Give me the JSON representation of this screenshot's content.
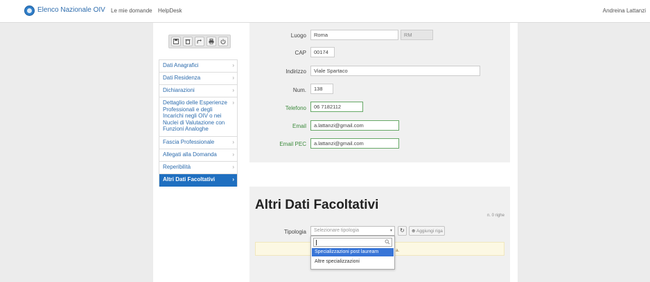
{
  "navbar": {
    "brand": "Elenco Nazionale OIV",
    "links": [
      "Le mie domande",
      "HelpDesk"
    ],
    "user": "Andreina Lattanzi"
  },
  "toolbar": {
    "buttons": [
      "save-icon",
      "delete-icon",
      "share-icon",
      "print-icon",
      "power-icon"
    ]
  },
  "menu": {
    "items": [
      {
        "label": "Dati Anagrafici"
      },
      {
        "label": "Dati Residenza"
      },
      {
        "label": "Dichiarazioni"
      },
      {
        "label": "Dettaglio delle Esperienze Professionali e degli Incarichi negli OIV o nei Nuclei di Valutazione con Funzioni Analoghe"
      },
      {
        "label": "Fascia Professionale"
      },
      {
        "label": "Allegati alla Domanda"
      },
      {
        "label": "Reperibilità"
      },
      {
        "label": "Altri Dati Facoltativi",
        "active": true
      }
    ],
    "chevron": "›",
    "chevron_active": "›"
  },
  "form": {
    "luogo": {
      "label": "Luogo",
      "value": "Roma",
      "prov": "RM"
    },
    "cap": {
      "label": "CAP",
      "value": "00174"
    },
    "indirizzo": {
      "label": "Indirizzo",
      "value": "Viale Spartaco"
    },
    "num": {
      "label": "Num.",
      "value": "138"
    },
    "telefono": {
      "label": "Telefono",
      "value": "06 7182112"
    },
    "email": {
      "label": "Email",
      "value": "a.lattanzi@gmail.com"
    },
    "email_pec": {
      "label": "Email PEC",
      "value": "a.lattanzi@gmail.com"
    }
  },
  "altri": {
    "title": "Altri Dati Facoltativi",
    "n_righe": "n. 0 righe",
    "tipologia_label": "Tipologia",
    "select_placeholder": "Selezionare tipologia",
    "add_label": "Aggiungi riga",
    "alert_tail": "a.",
    "dropdown": {
      "search_value": "",
      "options": [
        "Specializzazioni post lauream",
        "Altre specializzazioni"
      ]
    }
  },
  "colors": {
    "accent": "#1f6fc0",
    "link": "#2d6cad",
    "valid_green": "#66a866",
    "highlight": "#3875d7"
  }
}
